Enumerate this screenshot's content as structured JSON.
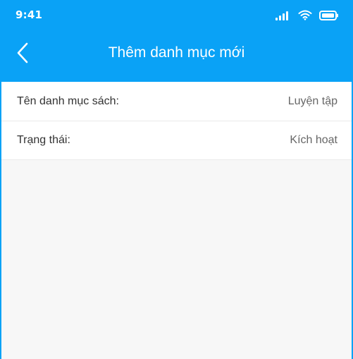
{
  "status_bar": {
    "time": "9:41",
    "icons": [
      "signal-icon",
      "wifi-icon",
      "battery-icon"
    ]
  },
  "header": {
    "title": "Thêm danh mục mới",
    "back_icon": "chevron-left-icon",
    "background_color": "#0aa2f6"
  },
  "form": {
    "rows": [
      {
        "label": "Tên danh mục sách:",
        "value": "Luyện tập"
      },
      {
        "label": "Trạng thái:",
        "value": "Kích hoạt"
      }
    ]
  },
  "colors": {
    "accent": "#0aa2f6",
    "background": "#f7f7f7",
    "row_background": "#ffffff",
    "label_text": "#333333",
    "value_text": "#666666"
  }
}
